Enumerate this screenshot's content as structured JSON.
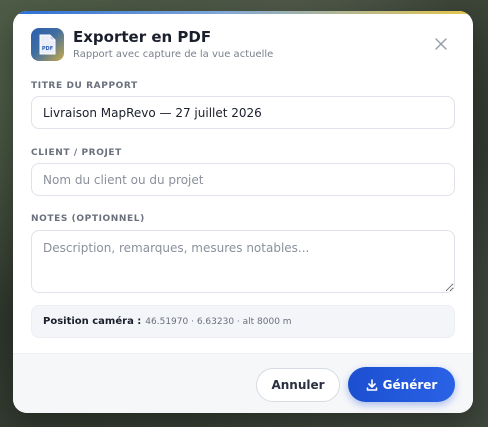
{
  "dialog": {
    "title": "Exporter en PDF",
    "subtitle": "Rapport avec capture de la vue actuelle",
    "logo_text": "PDF"
  },
  "form": {
    "report_title": {
      "label": "TITRE DU RAPPORT",
      "value": "Livraison MapRevo — 27 juillet 2026"
    },
    "client": {
      "label": "CLIENT / PROJET",
      "placeholder": "Nom du client ou du projet"
    },
    "notes": {
      "label": "NOTES (OPTIONNEL)",
      "placeholder": "Description, remarques, mesures notables..."
    }
  },
  "camera": {
    "label": "Position caméra :",
    "value": "46.51970 · 6.63230 · alt 8000 m"
  },
  "footer": {
    "cancel_label": "Annuler",
    "generate_label": "Générer"
  },
  "icons": {
    "logo": "pdf-document-icon",
    "close": "close-icon",
    "generate": "download-icon"
  },
  "colors": {
    "accent": "#2a62e6",
    "title": "#1a1f2b",
    "muted": "#7a808c"
  }
}
